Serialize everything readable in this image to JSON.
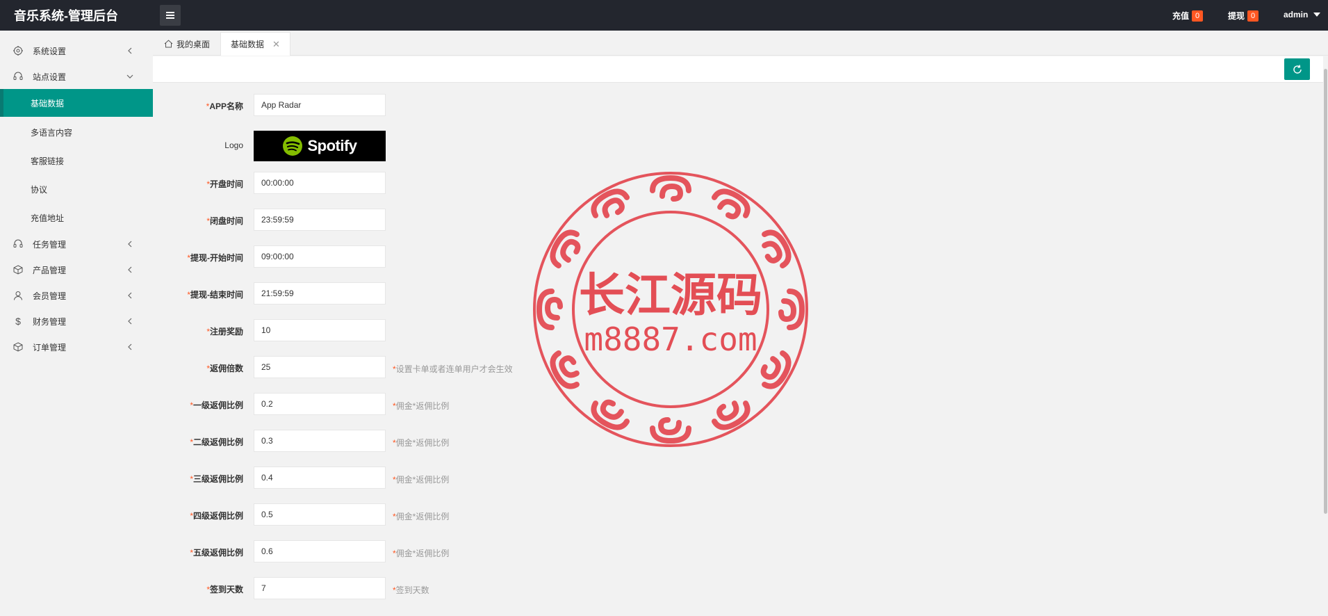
{
  "header": {
    "title": "音乐系统-管理后台",
    "recharge_label": "充值",
    "recharge_count": "0",
    "withdraw_label": "提现",
    "withdraw_count": "0",
    "user": "admin"
  },
  "sidebar": {
    "items": [
      {
        "label": "系统设置",
        "icon": "gear-icon"
      },
      {
        "label": "站点设置",
        "icon": "headset-icon"
      },
      {
        "label": "任务管理",
        "icon": "headset-icon"
      },
      {
        "label": "产品管理",
        "icon": "box-icon"
      },
      {
        "label": "会员管理",
        "icon": "user-icon"
      },
      {
        "label": "财务管理",
        "icon": "dollar-icon"
      },
      {
        "label": "订单管理",
        "icon": "box-icon"
      }
    ],
    "sub_items": [
      "基础数据",
      "多语言内容",
      "客服链接",
      "协议",
      "充值地址"
    ]
  },
  "tabs": {
    "home": "我的桌面",
    "current": "基础数据"
  },
  "form": {
    "required_mark": "*",
    "fields": [
      {
        "label": "APP名称",
        "value": "App Radar",
        "hint": ""
      },
      {
        "label": "Logo",
        "value": "",
        "hint": ""
      },
      {
        "label": "开盘时间",
        "value": "00:00:00",
        "hint": ""
      },
      {
        "label": "闭盘时间",
        "value": "23:59:59",
        "hint": ""
      },
      {
        "label": "提现-开始时间",
        "value": "09:00:00",
        "hint": ""
      },
      {
        "label": "提现-结束时间",
        "value": "21:59:59",
        "hint": ""
      },
      {
        "label": "注册奖励",
        "value": "10",
        "hint": ""
      },
      {
        "label": "返佣倍数",
        "value": "25",
        "hint": "设置卡单或者连单用户才会生效"
      },
      {
        "label": "一级返佣比例",
        "value": "0.2",
        "hint": "佣金*返佣比例"
      },
      {
        "label": "二级返佣比例",
        "value": "0.3",
        "hint": "佣金*返佣比例"
      },
      {
        "label": "三级返佣比例",
        "value": "0.4",
        "hint": "佣金*返佣比例"
      },
      {
        "label": "四级返佣比例",
        "value": "0.5",
        "hint": "佣金*返佣比例"
      },
      {
        "label": "五级返佣比例",
        "value": "0.6",
        "hint": "佣金*返佣比例"
      },
      {
        "label": "签到天数",
        "value": "7",
        "hint": "签到天数"
      }
    ],
    "logo_text": "Spotify"
  },
  "watermark": {
    "line1": "长江源码",
    "line2": "m8887.com"
  },
  "colors": {
    "header_bg": "#23262e",
    "accent": "#009688",
    "badge": "#ff5722",
    "watermark": "#e0313a"
  }
}
